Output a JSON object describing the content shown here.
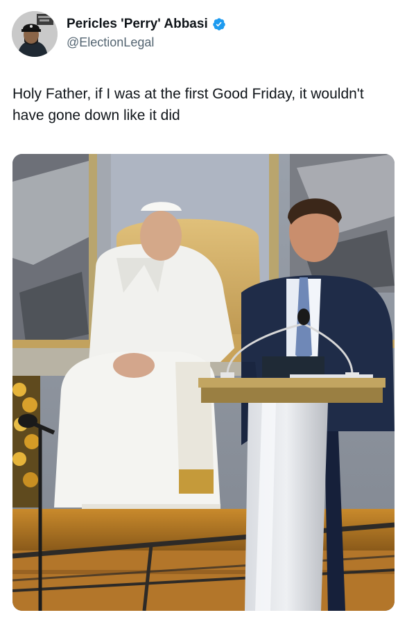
{
  "author": {
    "display_name": "Pericles 'Perry' Abbasi",
    "handle": "@ElectionLegal",
    "verified": true,
    "avatar_icon": "profile-photo"
  },
  "tweet": {
    "text": "Holy Father, if I was at the first Good Friday, it wouldn't have gone down like it did"
  },
  "media": {
    "type": "photo",
    "icon": "photo-pope-seated-speaker-at-podium"
  },
  "colors": {
    "verified_blue": "#1d9bf0",
    "text_primary": "#0f1419",
    "text_secondary": "#536471"
  }
}
